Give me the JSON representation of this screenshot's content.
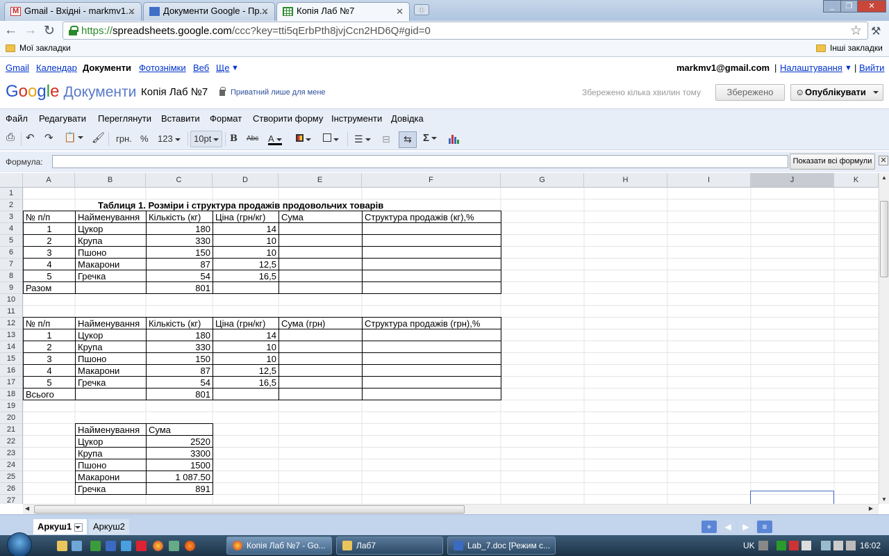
{
  "browser": {
    "tabs": [
      {
        "title": "Gmail - Вхідні - markmv1...",
        "icon": "gmail-icon"
      },
      {
        "title": "Документи Google - Пр...",
        "icon": "docs-icon"
      },
      {
        "title": "Копія Лаб №7",
        "icon": "spreadsheet-icon"
      }
    ],
    "url_https": "https://",
    "url_host": "spreadsheets.google.com",
    "url_path": "/ccc?key=tti5qErbPth8jvjCcn2HD6Q#gid=0",
    "bookmarks_left": "Мої закладки",
    "bookmarks_right": "Інші закладки"
  },
  "gbar": {
    "gmail": "Gmail",
    "calendar": "Календар",
    "documents": "Документи",
    "photos": "Фотознімки",
    "web": "Веб",
    "more": "Ще",
    "more_caret": "▼",
    "email": "markmv1@gmail.com",
    "separator": "|",
    "settings": "Налаштування",
    "settings_caret": "▼",
    "signout": "Вийти"
  },
  "header": {
    "logo_g": "G",
    "logo_o1": "o",
    "logo_o2": "o",
    "logo_g2": "g",
    "logo_l": "l",
    "logo_e": "e",
    "logo_product": "Документи",
    "doc_title": "Копія Лаб №7",
    "privacy": "Приватний лише для мене",
    "saved_message": "Збережено кілька хвилин тому",
    "saved_button": "Збережено",
    "publish_button": "Опублікувати"
  },
  "menu": [
    "Файл",
    "Редагувати",
    "Переглянути",
    "Вставити",
    "Формат",
    "Створити форму",
    "Інструменти",
    "Довідка"
  ],
  "toolbar": {
    "currency": "грн.",
    "percent": "%",
    "number_format": "123",
    "font_size": "10pt",
    "bold": "B",
    "strike": "Abc",
    "font_color": "A",
    "sum": "Σ"
  },
  "formula": {
    "label": "Формула:",
    "value": "",
    "show_all": "Показати всі формули",
    "close": "✕"
  },
  "grid": {
    "columns": [
      "A",
      "B",
      "C",
      "D",
      "E",
      "F",
      "G",
      "H",
      "I",
      "J",
      "K"
    ],
    "selected_column": "J",
    "row_numbers": [
      "1",
      "2",
      "3",
      "4",
      "5",
      "6",
      "7",
      "8",
      "9",
      "10",
      "11",
      "12",
      "13",
      "14",
      "15",
      "16",
      "17",
      "18",
      "19",
      "20",
      "21",
      "22",
      "23",
      "24",
      "25",
      "26",
      "27"
    ],
    "title": "Таблиця 1. Розміри і структура продажів продовольчих товарів",
    "table1": {
      "headers": [
        "№ п/п",
        "Найменування",
        "Кількість (кг)",
        "Ціна (грн/кг)",
        "Сума",
        "Структура продажів (кг),%"
      ],
      "rows": [
        [
          "1",
          "Цукор",
          "180",
          "14",
          "",
          ""
        ],
        [
          "2",
          "Крупа",
          "330",
          "10",
          "",
          ""
        ],
        [
          "3",
          "Пшоно",
          "150",
          "10",
          "",
          ""
        ],
        [
          "4",
          "Макарони",
          "87",
          "12,5",
          "",
          ""
        ],
        [
          "5",
          "Гречка",
          "54",
          "16,5",
          "",
          ""
        ]
      ],
      "total": [
        "Разом",
        "",
        "801",
        "",
        "",
        ""
      ]
    },
    "table2": {
      "headers": [
        "№ п/п",
        "Найменування",
        "Кількість (кг)",
        "Ціна (грн/кг)",
        "Сума (грн)",
        "Структура продажів (грн),%"
      ],
      "rows": [
        [
          "1",
          "Цукор",
          "180",
          "14",
          "",
          ""
        ],
        [
          "2",
          "Крупа",
          "330",
          "10",
          "",
          ""
        ],
        [
          "3",
          "Пшоно",
          "150",
          "10",
          "",
          ""
        ],
        [
          "4",
          "Макарони",
          "87",
          "12,5",
          "",
          ""
        ],
        [
          "5",
          "Гречка",
          "54",
          "16,5",
          "",
          ""
        ]
      ],
      "total": [
        "Всього",
        "",
        "801",
        "",
        "",
        ""
      ]
    },
    "table3": {
      "headers": [
        "Найменування",
        "Сума"
      ],
      "rows": [
        [
          "Цукор",
          "2520"
        ],
        [
          "Крупа",
          "3300"
        ],
        [
          "Пшоно",
          "1500"
        ],
        [
          "Макарони",
          "1 087.50"
        ],
        [
          "Гречка",
          "891"
        ]
      ]
    }
  },
  "sheets": {
    "tabs": [
      "Аркуш1",
      "Аркуш2"
    ],
    "active": "Аркуш1"
  },
  "taskbar": {
    "items": [
      "Копія Лаб №7 - Go...",
      "Лаб7",
      "Lab_7.doc [Режим с..."
    ],
    "language": "UK",
    "clock": "16:02"
  },
  "colors": {
    "accent": "#3f6fc7",
    "menu_bg": "#e8eef7",
    "sheet_bar": "#c3d5ec",
    "taskbar": "#1d3347"
  }
}
